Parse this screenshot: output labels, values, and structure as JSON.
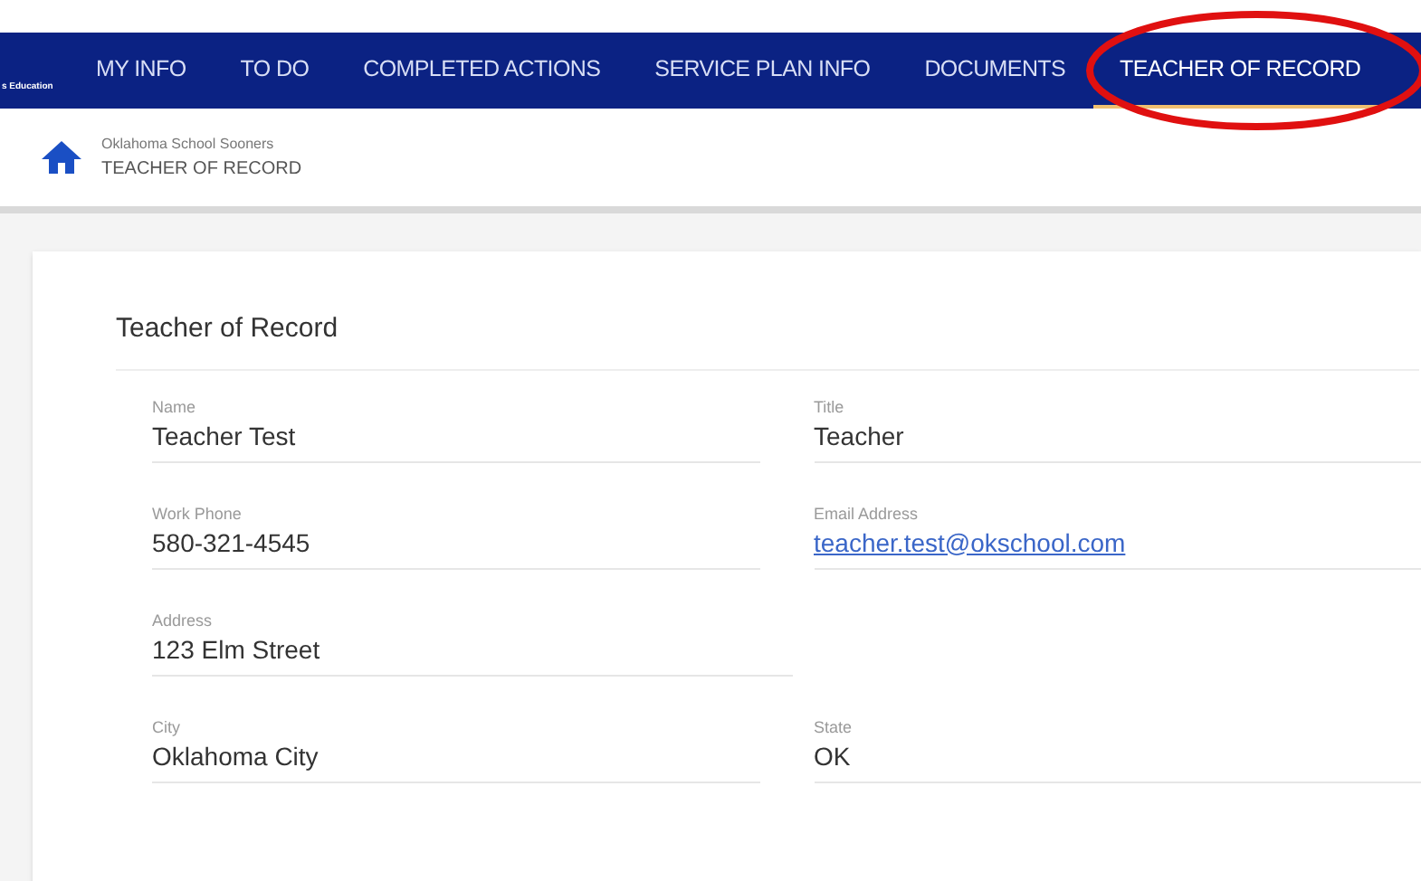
{
  "nav": {
    "logo_fragment": "s Education",
    "tabs": [
      {
        "label": "MY INFO",
        "selected": false
      },
      {
        "label": "TO DO",
        "selected": false
      },
      {
        "label": "COMPLETED ACTIONS",
        "selected": false
      },
      {
        "label": "SERVICE PLAN INFO",
        "selected": false
      },
      {
        "label": "DOCUMENTS",
        "selected": false
      },
      {
        "label": "TEACHER OF RECORD",
        "selected": true
      }
    ]
  },
  "breadcrumb": {
    "parent": "Oklahoma School Sooners",
    "current": "TEACHER OF RECORD"
  },
  "card": {
    "title": "Teacher of Record",
    "rows": [
      [
        {
          "label": "Name",
          "value": "Teacher Test",
          "kind": "text"
        },
        {
          "label": "Title",
          "value": "Teacher",
          "kind": "text"
        }
      ],
      [
        {
          "label": "Work Phone",
          "value": "580-321-4545",
          "kind": "text"
        },
        {
          "label": "Email Address",
          "value": "teacher.test@okschool.com",
          "kind": "link"
        }
      ],
      [
        {
          "label": "Address",
          "value": "123 Elm Street",
          "kind": "text"
        }
      ],
      [
        {
          "label": "City",
          "value": "Oklahoma City",
          "kind": "text"
        },
        {
          "label": "State",
          "value": "OK",
          "kind": "text"
        }
      ]
    ]
  }
}
